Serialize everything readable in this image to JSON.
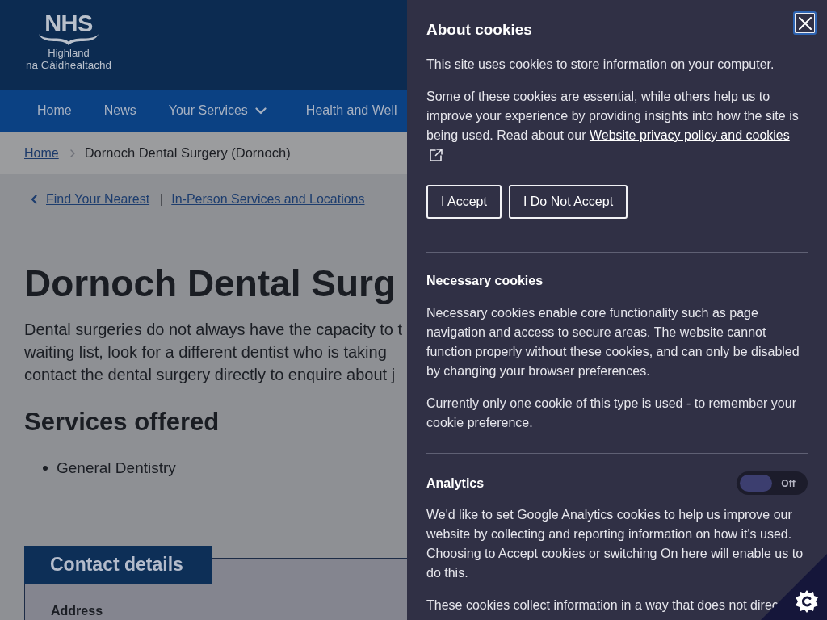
{
  "header": {
    "logo": {
      "wordmark": "NHS",
      "line_1": "Highland",
      "line_2": "na Gàidhealtachd"
    }
  },
  "nav": {
    "items": [
      {
        "label": "Home",
        "has_menu": false
      },
      {
        "label": "News",
        "has_menu": false
      },
      {
        "label": "Your Services",
        "has_menu": true
      },
      {
        "label": "Health and Well",
        "has_menu": false
      }
    ]
  },
  "breadcrumb": [
    {
      "label": "Home",
      "kind": "link"
    },
    {
      "label": "Dornoch Dental Surgery (Dornoch)",
      "kind": "current"
    }
  ],
  "back_links": {
    "items": [
      {
        "label": "Find Your Nearest",
        "kind": "back"
      },
      {
        "label": "In-Person Services and Locations",
        "kind": "link"
      }
    ],
    "separator": "|"
  },
  "page": {
    "title": "Dornoch Dental Surg",
    "intro_lines": [
      "Dental surgeries do not always have the capacity to t",
      "waiting list, look for a different dentist who is taking",
      "contact the dental surgery directly to enquire about j"
    ],
    "services_heading": "Services offered",
    "services": [
      "General Dentistry"
    ],
    "contact": {
      "heading": "Contact details",
      "address_label": "Address"
    }
  },
  "cookie_panel": {
    "close_button": {
      "focused": true
    },
    "title": "About cookies",
    "intro": "This site uses cookies to store information on your computer.",
    "policy_text": "Some of these cookies are essential, while others help us to improve your experience by providing insights into how the site is being used. Read about our",
    "policy_link": "Website privacy policy and cookies",
    "buttons": [
      "I Accept",
      "I Do Not Accept"
    ],
    "sections": [
      {
        "kind": "fixed",
        "title": "Necessary cookies",
        "paragraphs": [
          "Necessary cookies enable core functionality such as page navigation and access to secure areas. The website cannot function properly without these cookies, and can only be disabled by changing your browser preferences.",
          "Currently only one cookie of this type is used - to remember your cookie preference."
        ]
      },
      {
        "kind": "toggle",
        "title": "Analytics",
        "toggle": {
          "on": false,
          "label": "Off"
        },
        "paragraphs": [
          "We'd like to set Google Analytics cookies to help us improve our website by collecting and reporting information on how it's used. Choosing to Accept cookies or switching On here will enable us to do this.",
          "These cookies collect information in a way that does not direc"
        ]
      }
    ]
  }
}
